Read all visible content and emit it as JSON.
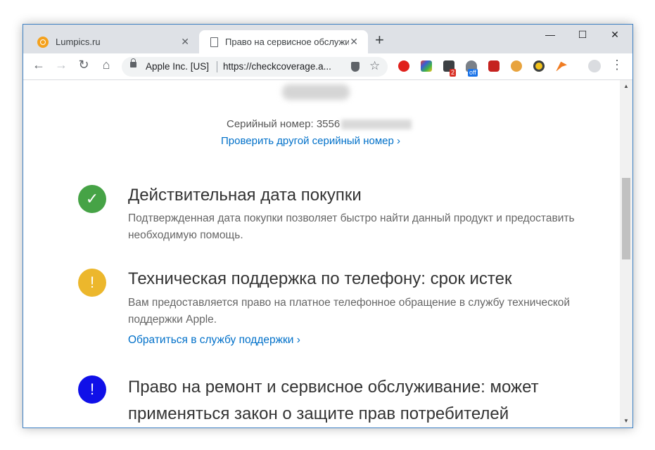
{
  "tabs": [
    {
      "title": "Lumpics.ru",
      "close": "✕"
    },
    {
      "title": "Право на сервисное обслужива",
      "close": "✕"
    }
  ],
  "newtab": "+",
  "window_controls": {
    "minimize": "—",
    "maximize": "☐",
    "close": "✕"
  },
  "toolbar": {
    "back": "←",
    "forward": "→",
    "reload": "↻",
    "home": "⌂",
    "org": "Apple Inc. [US]",
    "url": "https://checkcoverage.a...",
    "star": "☆",
    "menu": "⋮"
  },
  "extensions": {
    "badge_2": "2",
    "badge_off": "off"
  },
  "content": {
    "serial_label": "Серийный номер: 3556",
    "check_other": "Проверить другой серийный номер ›",
    "sections": [
      {
        "icon": "✓",
        "color": "#46a346",
        "title": "Действительная дата покупки",
        "text": "Подтвержденная дата покупки позволяет быстро найти данный продукт и предоставить необходимую помощь."
      },
      {
        "icon": "!",
        "color": "#ecb72c",
        "title": "Техническая поддержка по телефону: срок истек",
        "text": "Вам предоставляется право на платное телефонное обращение в службу технической поддержки Apple.",
        "link": "Обратиться в службу поддержки ›"
      },
      {
        "icon": "!",
        "color": "#1010e8",
        "title": "Право на ремонт и сервисное обслуживание: может применяться закон о защите прав потребителей"
      }
    ]
  }
}
